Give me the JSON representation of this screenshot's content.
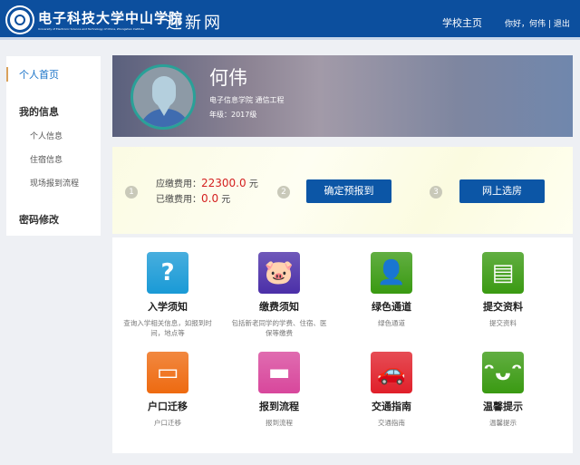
{
  "header": {
    "school_name": "电子科技大学中山学院",
    "school_name_en": "University of Electronic Science and Technology of China, Zhongshan Institute",
    "site_title": "迎新网",
    "home_link": "学校主页",
    "greeting": "你好，何伟",
    "separator": "|",
    "logout": "退出",
    "color": "#0c4f9e"
  },
  "sidebar": {
    "items": [
      {
        "label": "个人首页",
        "type": "active"
      },
      {
        "label": "我的信息",
        "type": "head"
      },
      {
        "label": "个人信息",
        "type": "sub"
      },
      {
        "label": "住宿信息",
        "type": "sub"
      },
      {
        "label": "现场报到流程",
        "type": "sub"
      },
      {
        "label": "密码修改",
        "type": "head"
      }
    ]
  },
  "profile": {
    "name": "何伟",
    "department": "电子信息学院  通信工程",
    "grade": "年级：2017级"
  },
  "fees": {
    "steps": [
      "1",
      "2",
      "3"
    ],
    "due_label": "应缴费用：",
    "due_value": "22300.0",
    "paid_label": "已缴费用：",
    "paid_value": "0.0",
    "unit": "元",
    "confirm_button": "确定预报到",
    "room_button": "网上选房"
  },
  "tiles": [
    {
      "title": "入学须知",
      "desc": "查询入学相关信息，如报到时间，地点等",
      "icon": "question-icon",
      "color": "#1a9ad6"
    },
    {
      "title": "缴费须知",
      "desc": "包括新老同学的学费、住宿、医保等缴费",
      "icon": "piggy-bank-icon",
      "color": "#4b2fa8"
    },
    {
      "title": "绿色通道",
      "desc": "绿色通道",
      "icon": "person-icon",
      "color": "#3a9a12"
    },
    {
      "title": "提交资料",
      "desc": "提交资料",
      "icon": "documents-icon",
      "color": "#3a9a12"
    },
    {
      "title": "户口迁移",
      "desc": "户口迁移",
      "icon": "id-card-icon",
      "color": "#ee6a10"
    },
    {
      "title": "报到流程",
      "desc": "报到流程",
      "icon": "bed-icon",
      "color": "#d8479c"
    },
    {
      "title": "交通指南",
      "desc": "交通指南",
      "icon": "car-icon",
      "color": "#e0202a"
    },
    {
      "title": "温馨提示",
      "desc": "温馨提示",
      "icon": "smiley-icon",
      "color": "#3a9a12"
    }
  ]
}
